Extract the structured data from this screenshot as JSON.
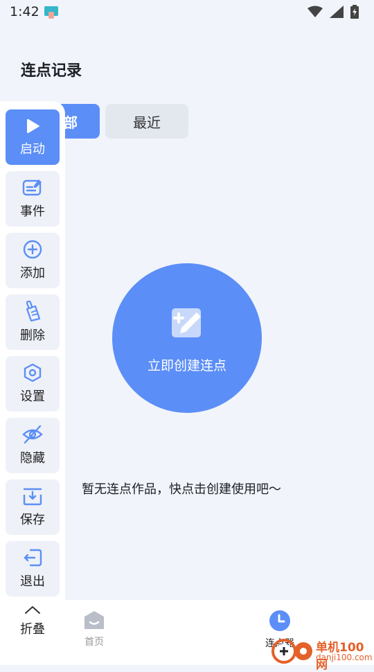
{
  "status_bar": {
    "time": "1:42"
  },
  "page": {
    "title": "连点记录"
  },
  "tabs": [
    {
      "label": "部"
    },
    {
      "label": "最近"
    }
  ],
  "create": {
    "label": "立即创建连点"
  },
  "empty_state": {
    "text": "暂无连点作品，快点击创建使用吧～"
  },
  "float_panel": {
    "items": [
      {
        "label": "启动",
        "icon": "play-icon"
      },
      {
        "label": "事件",
        "icon": "edit-card-icon"
      },
      {
        "label": "添加",
        "icon": "plus-circle-icon"
      },
      {
        "label": "删除",
        "icon": "broom-icon"
      },
      {
        "label": "设置",
        "icon": "hexagon-gear-icon"
      },
      {
        "label": "隐藏",
        "icon": "eye-off-icon"
      },
      {
        "label": "保存",
        "icon": "tray-download-icon"
      },
      {
        "label": "退出",
        "icon": "exit-icon"
      }
    ],
    "fold_label": "折叠"
  },
  "bottom_nav": {
    "home_label": "首页",
    "clicker_label": "连点器"
  },
  "watermark": {
    "brand": "单机100网",
    "url": "danji100.com"
  },
  "colors": {
    "accent": "#5b8ef7",
    "background": "#f1f4fb",
    "watermark": "#e4612a"
  }
}
